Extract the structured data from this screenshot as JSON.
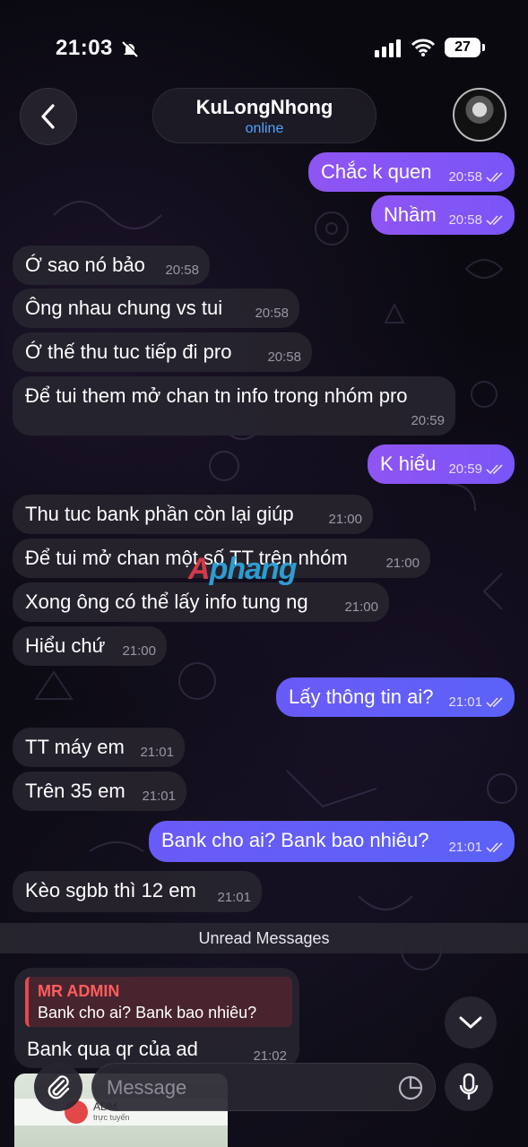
{
  "status_bar": {
    "time": "21:03",
    "battery": "27"
  },
  "header": {
    "name": "KuLongNhong",
    "presence": "online"
  },
  "messages": [
    {
      "dir": "out",
      "text": "Chắc k quen",
      "time": "20:58"
    },
    {
      "dir": "out",
      "text": "Nhầm",
      "time": "20:58"
    },
    {
      "dir": "in",
      "text": "Ớ sao nó bảo",
      "time": "20:58"
    },
    {
      "dir": "in",
      "text": "Ông nhau chung vs tui",
      "time": "20:58"
    },
    {
      "dir": "in",
      "text": "Ớ thế thu tuc tiếp đi pro",
      "time": "20:58"
    },
    {
      "dir": "in",
      "text": "Để tui them mở chan tn info trong nhóm pro",
      "time": "20:59"
    },
    {
      "dir": "out",
      "text": "K hiểu",
      "time": "20:59"
    },
    {
      "dir": "in",
      "text": "Thu tuc bank phần còn lại giúp",
      "time": "21:00"
    },
    {
      "dir": "in",
      "text": "Để tui mở chan một số TT trên nhóm",
      "time": "21:00"
    },
    {
      "dir": "in",
      "text": "Xong ông có thể lấy info tung ng",
      "time": "21:00"
    },
    {
      "dir": "in",
      "text": "Hiểu chứ",
      "time": "21:00"
    },
    {
      "dir": "out",
      "text": "Lấy thông tin ai?",
      "time": "21:01"
    },
    {
      "dir": "in",
      "text": "TT máy em",
      "time": "21:01"
    },
    {
      "dir": "in",
      "text": "Trên 35 em",
      "time": "21:01"
    },
    {
      "dir": "out",
      "text": "Bank cho ai? Bank bao nhiêu?",
      "time": "21:01"
    },
    {
      "dir": "in",
      "text": "Kèo sgbb thì 12 em",
      "time": "21:01"
    }
  ],
  "unread_label": "Unread Messages",
  "reply": {
    "quote_name": "MR ADMIN",
    "quote_text": "Bank cho ai? Bank bao nhiêu?",
    "text": "Bank qua qr của ad",
    "time": "21:02"
  },
  "thumbnail": {
    "name": "ADM",
    "sub": "trực tuyến"
  },
  "composer": {
    "placeholder": "Message"
  },
  "watermark": {
    "part1": "A",
    "part2": "phang"
  }
}
